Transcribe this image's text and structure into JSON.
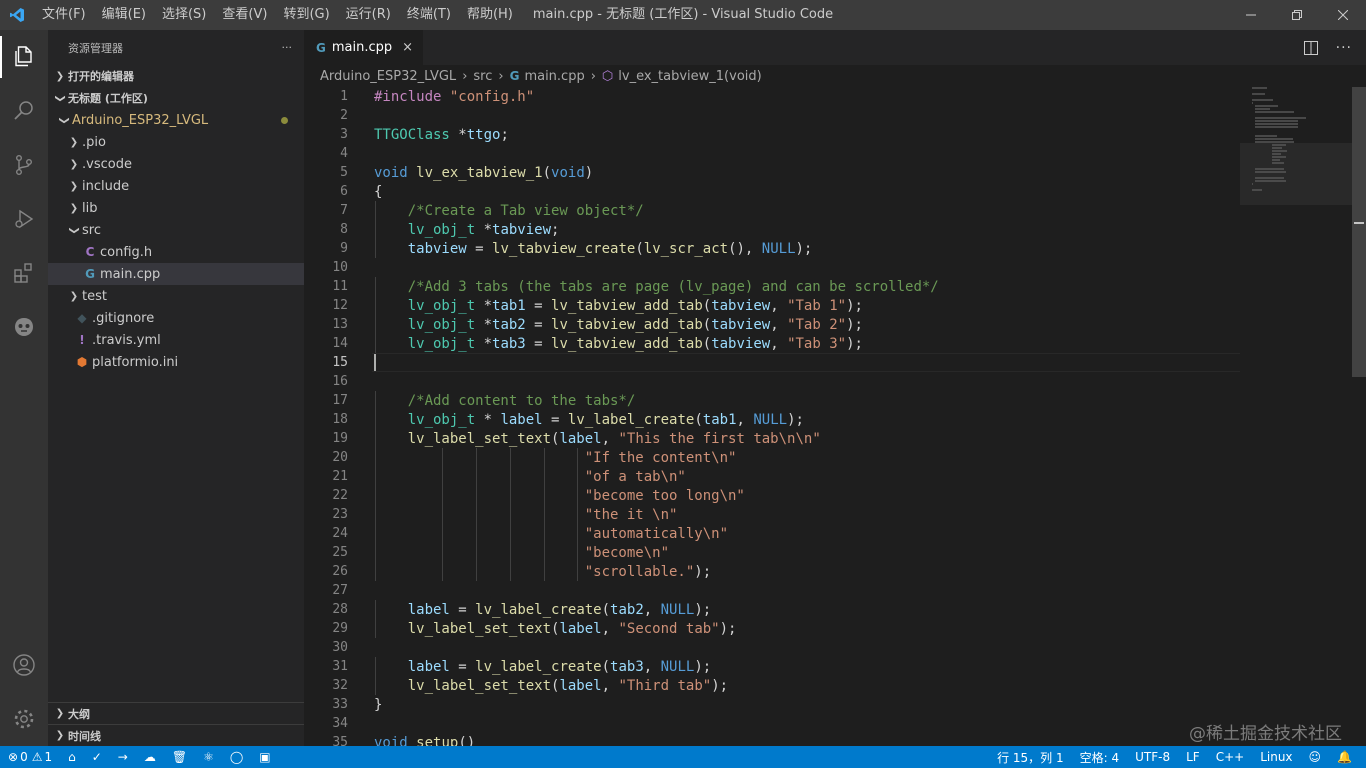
{
  "window": {
    "title": "main.cpp - 无标题 (工作区) - Visual Studio Code",
    "menu": [
      "文件(F)",
      "编辑(E)",
      "选择(S)",
      "查看(V)",
      "转到(G)",
      "运行(R)",
      "终端(T)",
      "帮助(H)"
    ]
  },
  "sidebar": {
    "header": "资源管理器",
    "more": "···",
    "open_editors": "打开的编辑器",
    "workspace": "无标题 (工作区)",
    "tree": [
      {
        "label": "Arduino_ESP32_LVGL",
        "indent": 1,
        "type": "folder-open",
        "root": true
      },
      {
        "label": ".pio",
        "indent": 2,
        "type": "folder"
      },
      {
        "label": ".vscode",
        "indent": 2,
        "type": "folder"
      },
      {
        "label": "include",
        "indent": 2,
        "type": "folder"
      },
      {
        "label": "lib",
        "indent": 2,
        "type": "folder"
      },
      {
        "label": "src",
        "indent": 2,
        "type": "folder-open"
      },
      {
        "label": "config.h",
        "indent": 3,
        "type": "c"
      },
      {
        "label": "main.cpp",
        "indent": 3,
        "type": "cpp",
        "selected": true
      },
      {
        "label": "test",
        "indent": 2,
        "type": "folder"
      },
      {
        "label": ".gitignore",
        "indent": 2,
        "type": "git"
      },
      {
        "label": ".travis.yml",
        "indent": 2,
        "type": "yml"
      },
      {
        "label": "platformio.ini",
        "indent": 2,
        "type": "pio"
      }
    ],
    "outline": "大纲",
    "timeline": "时间线"
  },
  "editor": {
    "tab_label": "main.cpp",
    "tab_close": "×",
    "breadcrumb": [
      "Arduino_ESP32_LVGL",
      "src",
      "main.cpp",
      "lv_ex_tabview_1(void)"
    ],
    "code_lines": [
      "#include \"config.h\"",
      "",
      "TTGOClass *ttgo;",
      "",
      "void lv_ex_tabview_1(void)",
      "{",
      "    /*Create a Tab view object*/",
      "    lv_obj_t *tabview;",
      "    tabview = lv_tabview_create(lv_scr_act(), NULL);",
      "",
      "    /*Add 3 tabs (the tabs are page (lv_page) and can be scrolled*/",
      "    lv_obj_t *tab1 = lv_tabview_add_tab(tabview, \"Tab 1\");",
      "    lv_obj_t *tab2 = lv_tabview_add_tab(tabview, \"Tab 2\");",
      "    lv_obj_t *tab3 = lv_tabview_add_tab(tabview, \"Tab 3\");",
      "",
      "",
      "    /*Add content to the tabs*/",
      "    lv_obj_t * label = lv_label_create(tab1, NULL);",
      "    lv_label_set_text(label, \"This the first tab\\n\\n\"",
      "                         \"If the content\\n\"",
      "                         \"of a tab\\n\"",
      "                         \"become too long\\n\"",
      "                         \"the it \\n\"",
      "                         \"automatically\\n\"",
      "                         \"become\\n\"",
      "                         \"scrollable.\");",
      "",
      "    label = lv_label_create(tab2, NULL);",
      "    lv_label_set_text(label, \"Second tab\");",
      "",
      "    label = lv_label_create(tab3, NULL);",
      "    lv_label_set_text(label, \"Third tab\");",
      "}",
      "",
      "void setup()"
    ],
    "current_line": 15
  },
  "statusbar": {
    "errors": "0",
    "warnings": "1",
    "position": "行 15，列 1",
    "spaces": "空格: 4",
    "encoding": "UTF-8",
    "eol": "LF",
    "language": "C++",
    "platform": "Linux"
  },
  "watermark": "@稀土掘金技术社区",
  "colors": {
    "statusbar": "#007acc",
    "activitybar": "#333333",
    "sidebar": "#252526",
    "editor": "#1e1e1e"
  }
}
